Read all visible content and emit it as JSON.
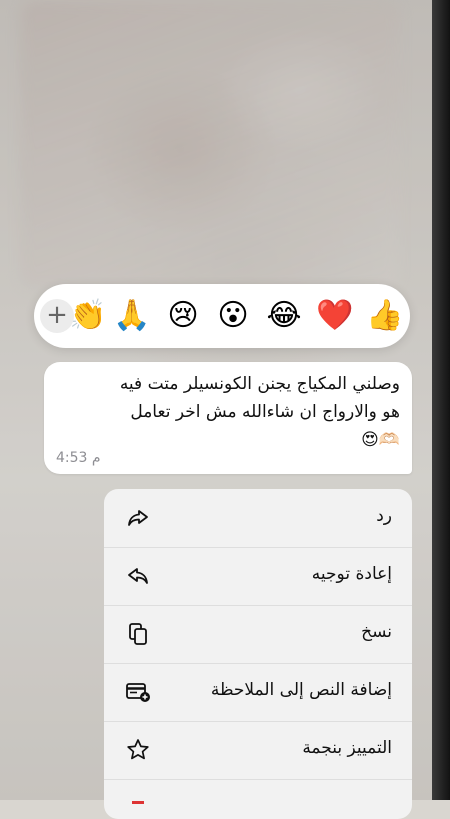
{
  "reactions": {
    "emojis": [
      "👍",
      "❤️",
      "😂",
      "😮",
      "😢",
      "🙏",
      "👏"
    ],
    "more_label": "+"
  },
  "message": {
    "lines": [
      "وصلني المكياج يجنن الكونسيلر متت فيه",
      "هو والارواج ان شاءالله مش اخر تعامل",
      "🫶🏻😍"
    ],
    "time": "4:53 م"
  },
  "menu": {
    "items": [
      {
        "label": "رد",
        "icon": "reply-icon"
      },
      {
        "label": "إعادة توجيه",
        "icon": "forward-icon"
      },
      {
        "label": "نسخ",
        "icon": "copy-icon"
      },
      {
        "label": "إضافة النص إلى الملاحظة",
        "icon": "add-note-icon"
      },
      {
        "label": "التمييز بنجمة",
        "icon": "star-icon"
      }
    ]
  },
  "colors": {
    "bubble": "#ffffff",
    "menu_bg": "#f2f2f2",
    "time_text": "#8e8e93"
  }
}
